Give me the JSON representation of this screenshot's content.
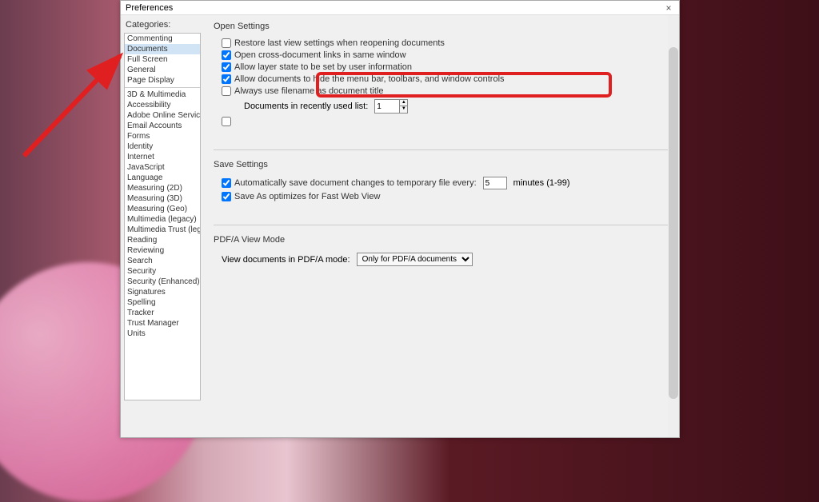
{
  "dialog": {
    "title": "Preferences",
    "close_icon": "×"
  },
  "sidebar": {
    "label": "Categories:",
    "group1": [
      {
        "label": "Commenting"
      },
      {
        "label": "Documents",
        "selected": true
      },
      {
        "label": "Full Screen"
      },
      {
        "label": "General"
      },
      {
        "label": "Page Display"
      }
    ],
    "group2": [
      {
        "label": "3D & Multimedia"
      },
      {
        "label": "Accessibility"
      },
      {
        "label": "Adobe Online Services"
      },
      {
        "label": "Email Accounts"
      },
      {
        "label": "Forms"
      },
      {
        "label": "Identity"
      },
      {
        "label": "Internet"
      },
      {
        "label": "JavaScript"
      },
      {
        "label": "Language"
      },
      {
        "label": "Measuring (2D)"
      },
      {
        "label": "Measuring (3D)"
      },
      {
        "label": "Measuring (Geo)"
      },
      {
        "label": "Multimedia (legacy)"
      },
      {
        "label": "Multimedia Trust (legacy)"
      },
      {
        "label": "Reading"
      },
      {
        "label": "Reviewing"
      },
      {
        "label": "Search"
      },
      {
        "label": "Security"
      },
      {
        "label": "Security (Enhanced)"
      },
      {
        "label": "Signatures"
      },
      {
        "label": "Spelling"
      },
      {
        "label": "Tracker"
      },
      {
        "label": "Trust Manager"
      },
      {
        "label": "Units"
      }
    ]
  },
  "open_settings": {
    "title": "Open Settings",
    "restore_last": {
      "checked": false,
      "label": "Restore last view settings when reopening documents"
    },
    "cross_doc": {
      "checked": true,
      "label": "Open cross-document links in same window"
    },
    "layer_state": {
      "checked": true,
      "label": "Allow layer state to be set by user information"
    },
    "hide_menu": {
      "checked": true,
      "label": "Allow documents to hide the menu bar, toolbars, and window controls"
    },
    "filename_title": {
      "checked": false,
      "label": "Always use filename as document title"
    },
    "recent_label": "Documents in recently used list:",
    "recent_value": "1",
    "extra_check": {
      "checked": false,
      "label": ""
    }
  },
  "save_settings": {
    "title": "Save Settings",
    "auto_save": {
      "checked": true,
      "label": "Automatically save document changes to temporary file every:"
    },
    "auto_save_value": "5",
    "auto_save_suffix": "minutes (1-99)",
    "fast_web": {
      "checked": true,
      "label": "Save As optimizes for Fast Web View"
    }
  },
  "pdfa": {
    "title": "PDF/A View Mode",
    "label": "View documents in PDF/A mode:",
    "value": "Only for PDF/A documents"
  },
  "annotation": {
    "highlight_color": "#e02020"
  }
}
